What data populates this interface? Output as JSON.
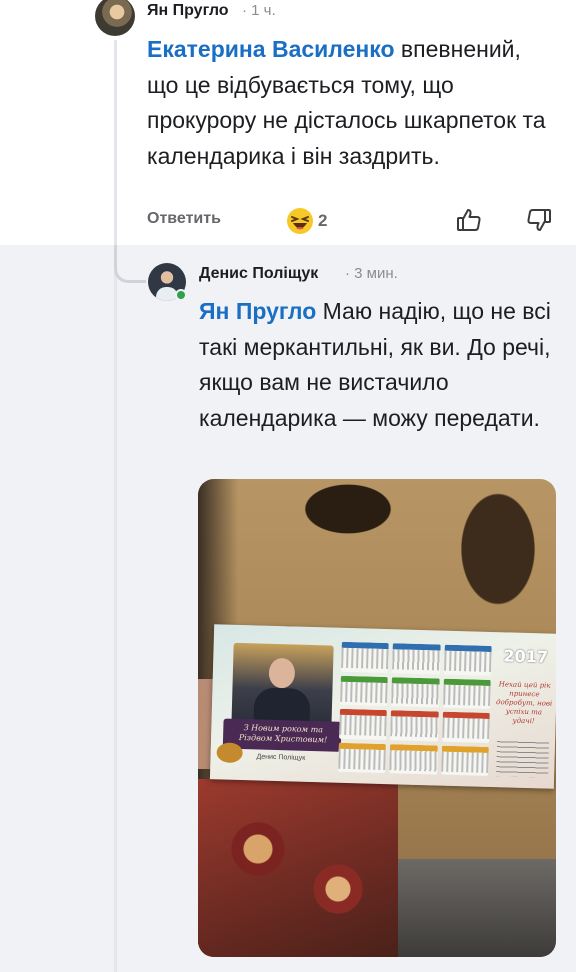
{
  "comment1": {
    "author": "Ян Пругло",
    "time": "· 1 ч.",
    "mention": "Екатерина Василенко",
    "text": " впевнений, що це відбувається тому, що прокурору не дісталось шкарпеток та календарика і він заздрить.",
    "reply_label": "Ответить",
    "reaction_emoji": "laughing-face-emoji",
    "reaction_count": "2",
    "like_icon": "thumbs-up-icon",
    "dislike_icon": "thumbs-down-icon"
  },
  "comment2": {
    "author": "Денис Поліщук",
    "time": "· 3 мин.",
    "mention": "Ян Пругло",
    "text": " Маю надію, що не всі такі меркантильні, як ви. До речі, якщо вам не вистачило календарика — можу передати.",
    "online": true,
    "attachment": {
      "kind": "photo",
      "calendar_year": "2017",
      "calendar_greeting": "З Новим роком та Різдвом Христовим!",
      "calendar_wish": "Нехай цей рік принесе добробут, нові успіхи та удачі!",
      "calendar_signature": "Денис Поліщук"
    }
  },
  "colors": {
    "mention": "#1a6fc4",
    "reply_bg": "#f0f2f5",
    "online": "#31a24c",
    "muted": "#65676b"
  }
}
